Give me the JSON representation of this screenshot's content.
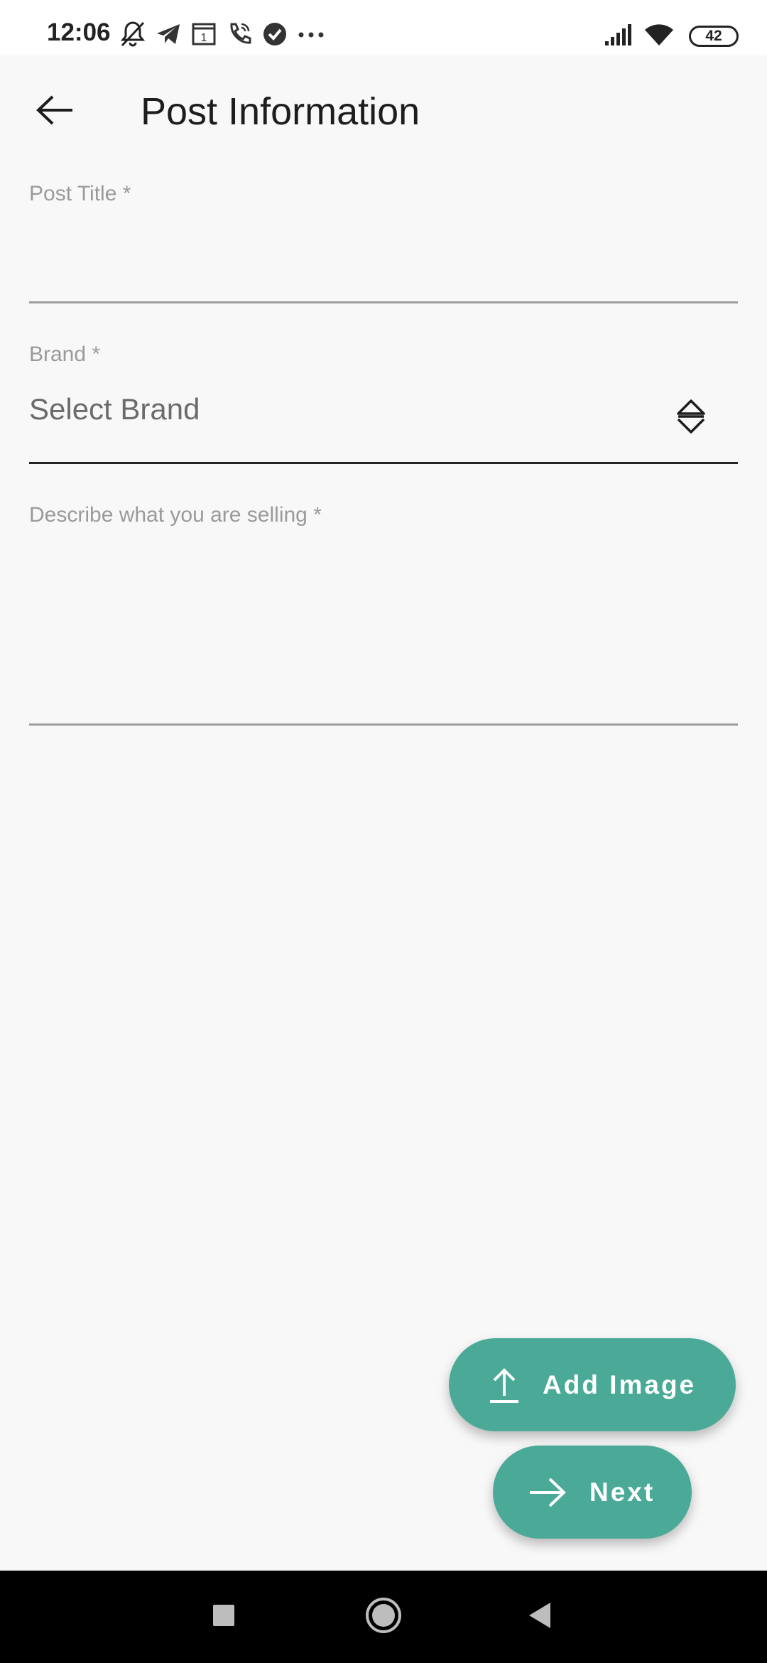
{
  "status_bar": {
    "time": "12:06",
    "left_icons": [
      "bell-muted-icon",
      "telegram-icon",
      "calendar-icon",
      "phone-call-icon",
      "check-circle-icon",
      "more-dots-icon"
    ],
    "calendar_day": "1",
    "right_icons": [
      "signal-icon",
      "wifi-icon",
      "battery-icon"
    ],
    "battery_level": "42"
  },
  "app_bar": {
    "back_icon": "arrow-left-icon",
    "title": "Post Information"
  },
  "form": {
    "post_title": {
      "label": "Post Title *",
      "value": ""
    },
    "brand": {
      "label": "Brand *",
      "selected": "Select Brand",
      "icon": "unfold-icon"
    },
    "description": {
      "label": "Describe what you are selling *",
      "value": ""
    }
  },
  "actions": {
    "add_image": {
      "label": "Add Image",
      "icon": "upload-icon"
    },
    "next": {
      "label": "Next",
      "icon": "arrow-right-icon"
    }
  },
  "nav_bar": {
    "items": [
      "recents-square-icon",
      "home-circle-icon",
      "back-triangle-icon"
    ]
  },
  "colors": {
    "accent": "#4aaa97",
    "background": "#f8f8f8",
    "nav_bar": "#000000"
  }
}
